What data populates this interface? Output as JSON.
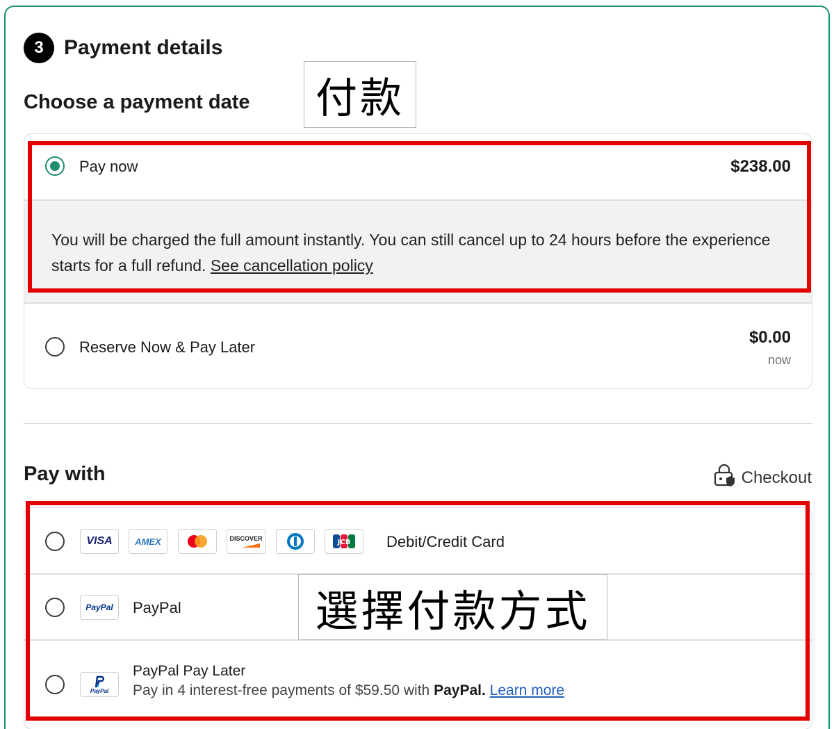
{
  "header": {
    "step_number": "3",
    "title": "Payment details",
    "subtitle": "Choose a payment date"
  },
  "annotations": {
    "payment_label": "付款",
    "choose_method_label": "選擇付款方式"
  },
  "payment_date": {
    "options": [
      {
        "label": "Pay now",
        "price": "$238.00",
        "selected": true,
        "info_text": "You will be charged the full amount instantly. You can still cancel up to 24 hours before the experience starts for a full refund.",
        "info_link": "See cancellation policy"
      },
      {
        "label": "Reserve Now & Pay Later",
        "price": "$0.00",
        "price_sub": "now",
        "selected": false
      }
    ]
  },
  "pay_with": {
    "title": "Pay with",
    "checkout_label": "Checkout",
    "methods": [
      {
        "label": "Debit/Credit Card",
        "logos": [
          "VISA",
          "AMEX",
          "mastercard",
          "DISCOVER",
          "Diners Club",
          "JCB"
        ]
      },
      {
        "label": "PayPal",
        "logo": "PayPal"
      },
      {
        "label": "PayPal Pay Later",
        "logo": "PayPal",
        "desc_prefix": "Pay in 4 interest-free payments of $59.50 with",
        "desc_brand": "PayPal.",
        "desc_link": "Learn more"
      }
    ]
  },
  "colors": {
    "accent": "#1f8f70",
    "highlight": "#e20000",
    "link": "#1f5fbf"
  }
}
